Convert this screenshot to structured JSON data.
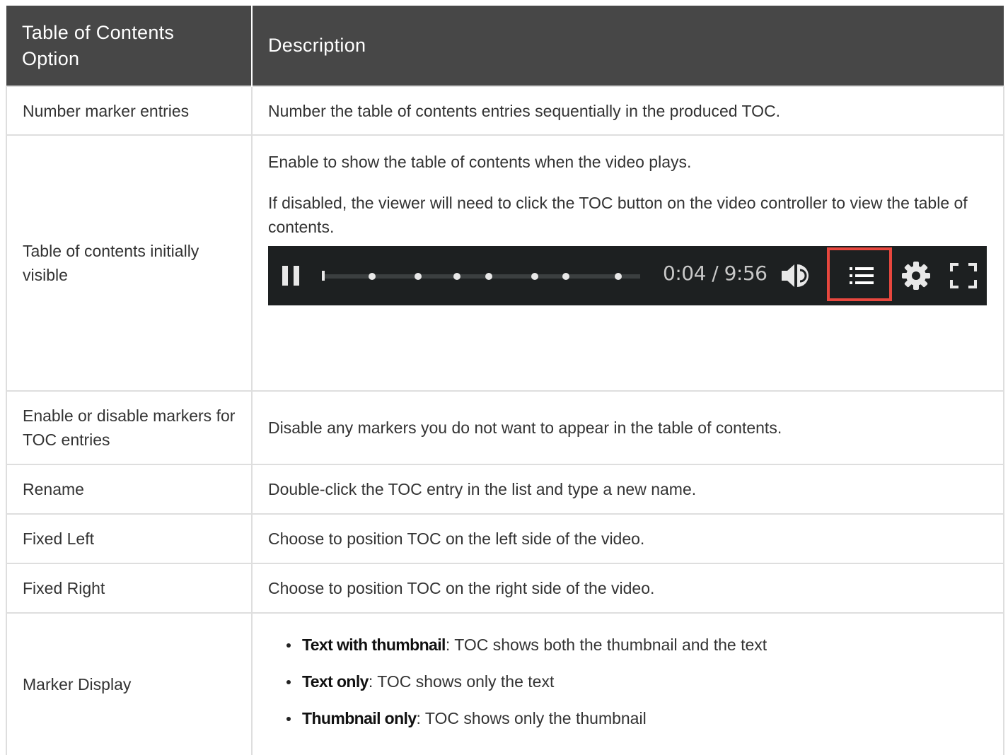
{
  "header": {
    "col1": "Table of Contents Option",
    "col2": "Description"
  },
  "rows": {
    "number_markers": {
      "option": "Number marker entries",
      "desc": "Number the table of contents entries sequentially in the produced TOC."
    },
    "initially_visible": {
      "option": "Table of contents initially visible",
      "desc1": "Enable to show the table of contents when the video plays.",
      "desc2": "If disabled, the viewer will need to click the TOC button on the video controller to view the table of contents."
    },
    "enable_disable": {
      "option": "Enable or disable markers for TOC entries",
      "desc": "Disable any markers you do not want to appear in the table of contents."
    },
    "rename": {
      "option": "Rename",
      "desc": "Double-click the TOC entry in the list and type a new name."
    },
    "fixed_left": {
      "option": "Fixed Left",
      "desc": "Choose to position TOC on the left side of the video."
    },
    "fixed_right": {
      "option": "Fixed Right",
      "desc": "Choose to position TOC on the right side of the video."
    },
    "marker_display": {
      "option": "Marker Display",
      "items": [
        {
          "term": "Text with thumbnail",
          "text": ": TOC shows both the thumbnail and the text"
        },
        {
          "term": "Text only",
          "text": ": TOC shows only the text"
        },
        {
          "term": "Thumbnail only",
          "text": ": TOC shows only the thumbnail"
        }
      ]
    }
  },
  "player": {
    "time": "0:04 / 9:56",
    "icons": [
      "pause-icon",
      "volume-icon",
      "toc-list-icon",
      "gear-icon",
      "fullscreen-icon"
    ],
    "highlight_color": "#e8473e",
    "marker_count": 7
  },
  "colors": {
    "header_bg": "#474747",
    "border": "#dedede",
    "player_bg": "#1d2021"
  }
}
